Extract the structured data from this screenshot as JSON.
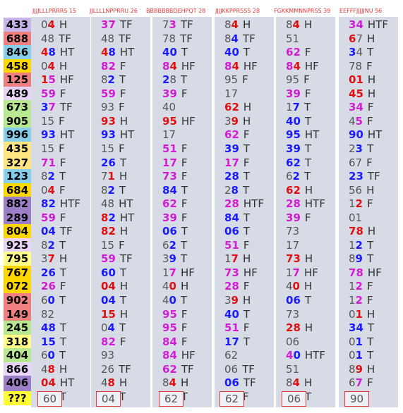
{
  "headers": [
    {
      "label": "JJJJLLLPRRRS 15"
    },
    {
      "label": "JJLLLLNPPRRU 26"
    },
    {
      "label": "BBBBBBBDEHPQT 28"
    },
    {
      "label": "JJJJKKPPRSSS 28"
    },
    {
      "label": "FGKKMMNNPRSS 39"
    },
    {
      "label": "EEFFFJJJJJNU 56"
    }
  ],
  "colors": {
    "blue": "#1a1aff",
    "red": "#e01010",
    "magenta": "#d41cd4",
    "gray": "#555555",
    "black": "#333333"
  },
  "rows": [
    {
      "id": "433",
      "bg": "#c8b4e8",
      "cells": [
        [
          "0",
          "4",
          "H",
          "gray",
          "red"
        ],
        [
          "3",
          "7",
          "TF",
          "magenta",
          "magenta"
        ],
        [
          "7",
          "3",
          "TF",
          "gray",
          "magenta"
        ],
        [
          "8",
          "4",
          "H",
          "gray",
          "red"
        ],
        [
          "8",
          "4",
          "H",
          "gray",
          "red"
        ],
        [
          "3",
          "4",
          "HTF",
          "magenta",
          "magenta"
        ]
      ]
    },
    {
      "id": "688",
      "bg": "#f08080",
      "cells": [
        [
          "4",
          "8",
          "TF",
          "gray",
          "gray"
        ],
        [
          "4",
          "8",
          "TF",
          "gray",
          "gray"
        ],
        [
          "7",
          "8",
          "TF",
          "gray",
          "gray"
        ],
        [
          "8",
          "4",
          "TF",
          "gray",
          "blue"
        ],
        [
          "5",
          "1",
          "",
          "gray",
          "gray"
        ],
        [
          "6",
          "7",
          "H",
          "red",
          "gray"
        ]
      ]
    },
    {
      "id": "846",
      "bg": "#87ceeb",
      "cells": [
        [
          "4",
          "8",
          "HT",
          "red",
          "blue"
        ],
        [
          "4",
          "8",
          "HT",
          "red",
          "blue"
        ],
        [
          "4",
          "0",
          "T",
          "blue",
          "blue"
        ],
        [
          "4",
          "0",
          "T",
          "blue",
          "blue"
        ],
        [
          "6",
          "2",
          "F",
          "magenta",
          "magenta"
        ],
        [
          "3",
          "4",
          "T",
          "blue",
          "gray"
        ]
      ]
    },
    {
      "id": "458",
      "bg": "#ffd700",
      "cells": [
        [
          "0",
          "4",
          "H",
          "gray",
          "red"
        ],
        [
          "8",
          "2",
          "F",
          "magenta",
          "magenta"
        ],
        [
          "8",
          "4",
          "HF",
          "magenta",
          "red"
        ],
        [
          "8",
          "4",
          "HF",
          "magenta",
          "red"
        ],
        [
          "8",
          "4",
          "HF",
          "magenta",
          "red"
        ],
        [
          "7",
          "8",
          "F",
          "gray",
          "gray"
        ]
      ]
    },
    {
      "id": "125",
      "bg": "#f08080",
      "cells": [
        [
          "1",
          "5",
          "HF",
          "red",
          "magenta"
        ],
        [
          "8",
          "2",
          "T",
          "gray",
          "blue"
        ],
        [
          "2",
          "8",
          "T",
          "blue",
          "gray"
        ],
        [
          "9",
          "5",
          "F",
          "gray",
          "gray"
        ],
        [
          "9",
          "5",
          "F",
          "gray",
          "gray"
        ],
        [
          "0",
          "1",
          "H",
          "red",
          "red"
        ]
      ]
    },
    {
      "id": "489",
      "bg": "#e8d4f8",
      "cells": [
        [
          "5",
          "9",
          "F",
          "magenta",
          "magenta"
        ],
        [
          "5",
          "9",
          "F",
          "magenta",
          "magenta"
        ],
        [
          "3",
          "9",
          "F",
          "magenta",
          "magenta"
        ],
        [
          "1",
          "7",
          "",
          "gray",
          "gray"
        ],
        [
          "3",
          "9",
          "F",
          "magenta",
          "magenta"
        ],
        [
          "4",
          "5",
          "H",
          "red",
          "red"
        ]
      ]
    },
    {
      "id": "673",
      "bg": "#b8e890",
      "cells": [
        [
          "3",
          "7",
          "TF",
          "blue",
          "magenta"
        ],
        [
          "9",
          "3",
          "F",
          "gray",
          "gray"
        ],
        [
          "4",
          "0",
          "",
          "gray",
          "gray"
        ],
        [
          "6",
          "2",
          "H",
          "red",
          "red"
        ],
        [
          "1",
          "7",
          "T",
          "gray",
          "blue"
        ],
        [
          "3",
          "4",
          "F",
          "magenta",
          "magenta"
        ]
      ]
    },
    {
      "id": "905",
      "bg": "#b8e890",
      "cells": [
        [
          "1",
          "5",
          "F",
          "gray",
          "gray"
        ],
        [
          "9",
          "3",
          "H",
          "red",
          "red"
        ],
        [
          "9",
          "5",
          "HF",
          "red",
          "red"
        ],
        [
          "3",
          "9",
          "H",
          "gray",
          "red"
        ],
        [
          "4",
          "0",
          "T",
          "blue",
          "blue"
        ],
        [
          "4",
          "5",
          "F",
          "gray",
          "magenta"
        ]
      ]
    },
    {
      "id": "996",
      "bg": "#87ceeb",
      "cells": [
        [
          "9",
          "3",
          "HT",
          "blue",
          "blue"
        ],
        [
          "9",
          "3",
          "HT",
          "blue",
          "blue"
        ],
        [
          "1",
          "7",
          "",
          "gray",
          "gray"
        ],
        [
          "6",
          "2",
          "F",
          "magenta",
          "magenta"
        ],
        [
          "9",
          "5",
          "HT",
          "blue",
          "blue"
        ],
        [
          "9",
          "0",
          "HT",
          "blue",
          "blue"
        ]
      ]
    },
    {
      "id": "435",
      "bg": "#ffe680",
      "cells": [
        [
          "1",
          "5",
          "F",
          "gray",
          "gray"
        ],
        [
          "1",
          "5",
          "F",
          "gray",
          "gray"
        ],
        [
          "5",
          "1",
          "F",
          "magenta",
          "magenta"
        ],
        [
          "3",
          "9",
          "T",
          "blue",
          "blue"
        ],
        [
          "3",
          "9",
          "T",
          "blue",
          "blue"
        ],
        [
          "2",
          "3",
          "T",
          "gray",
          "blue"
        ]
      ]
    },
    {
      "id": "327",
      "bg": "#ffe680",
      "cells": [
        [
          "7",
          "1",
          "F",
          "magenta",
          "magenta"
        ],
        [
          "2",
          "6",
          "T",
          "blue",
          "blue"
        ],
        [
          "1",
          "7",
          "F",
          "magenta",
          "magenta"
        ],
        [
          "1",
          "7",
          "F",
          "magenta",
          "magenta"
        ],
        [
          "6",
          "2",
          "T",
          "blue",
          "blue"
        ],
        [
          "6",
          "7",
          "F",
          "gray",
          "gray"
        ]
      ]
    },
    {
      "id": "123",
      "bg": "#87ceeb",
      "cells": [
        [
          "8",
          "2",
          "T",
          "gray",
          "blue"
        ],
        [
          "7",
          "1",
          "H",
          "gray",
          "red"
        ],
        [
          "7",
          "3",
          "F",
          "magenta",
          "magenta"
        ],
        [
          "2",
          "8",
          "T",
          "blue",
          "blue"
        ],
        [
          "6",
          "2",
          "T",
          "gray",
          "blue"
        ],
        [
          "2",
          "3",
          "TF",
          "blue",
          "blue"
        ]
      ]
    },
    {
      "id": "684",
      "bg": "#ffd700",
      "cells": [
        [
          "0",
          "4",
          "F",
          "gray",
          "red"
        ],
        [
          "8",
          "2",
          "T",
          "gray",
          "blue"
        ],
        [
          "8",
          "4",
          "T",
          "blue",
          "blue"
        ],
        [
          "2",
          "8",
          "T",
          "gray",
          "blue"
        ],
        [
          "6",
          "2",
          "H",
          "red",
          "red"
        ],
        [
          "5",
          "6",
          "H",
          "gray",
          "gray"
        ]
      ]
    },
    {
      "id": "882",
      "bg": "#9b7fc8",
      "cells": [
        [
          "8",
          "2",
          "HTF",
          "blue",
          "blue"
        ],
        [
          "4",
          "8",
          "HT",
          "gray",
          "gray"
        ],
        [
          "6",
          "2",
          "F",
          "magenta",
          "magenta"
        ],
        [
          "2",
          "8",
          "HTF",
          "magenta",
          "magenta"
        ],
        [
          "2",
          "8",
          "HTF",
          "magenta",
          "magenta"
        ],
        [
          "1",
          "2",
          "F",
          "gray",
          "red"
        ]
      ]
    },
    {
      "id": "289",
      "bg": "#9b7fc8",
      "cells": [
        [
          "5",
          "9",
          "F",
          "magenta",
          "magenta"
        ],
        [
          "8",
          "2",
          "HT",
          "red",
          "blue"
        ],
        [
          "3",
          "9",
          "F",
          "magenta",
          "magenta"
        ],
        [
          "8",
          "4",
          "T",
          "blue",
          "blue"
        ],
        [
          "3",
          "9",
          "F",
          "magenta",
          "magenta"
        ],
        [
          "0",
          "1",
          "",
          "gray",
          "gray"
        ]
      ]
    },
    {
      "id": "804",
      "bg": "#ffd700",
      "cells": [
        [
          "0",
          "4",
          "TF",
          "blue",
          "blue"
        ],
        [
          "8",
          "2",
          "H",
          "red",
          "red"
        ],
        [
          "0",
          "6",
          "T",
          "blue",
          "blue"
        ],
        [
          "0",
          "6",
          "T",
          "blue",
          "blue"
        ],
        [
          "7",
          "3",
          "",
          "gray",
          "gray"
        ],
        [
          "7",
          "8",
          "H",
          "red",
          "red"
        ]
      ]
    },
    {
      "id": "925",
      "bg": "#e8d4f8",
      "cells": [
        [
          "8",
          "2",
          "T",
          "gray",
          "blue"
        ],
        [
          "1",
          "5",
          "F",
          "gray",
          "gray"
        ],
        [
          "6",
          "2",
          "T",
          "gray",
          "blue"
        ],
        [
          "5",
          "1",
          "F",
          "magenta",
          "magenta"
        ],
        [
          "1",
          "7",
          "",
          "gray",
          "gray"
        ],
        [
          "1",
          "2",
          "T",
          "gray",
          "blue"
        ]
      ]
    },
    {
      "id": "795",
      "bg": "#ffff88",
      "cells": [
        [
          "3",
          "7",
          "H",
          "gray",
          "red"
        ],
        [
          "5",
          "9",
          "TF",
          "magenta",
          "magenta"
        ],
        [
          "3",
          "9",
          "T",
          "gray",
          "blue"
        ],
        [
          "1",
          "7",
          "H",
          "gray",
          "red"
        ],
        [
          "7",
          "3",
          "H",
          "red",
          "red"
        ],
        [
          "8",
          "9",
          "T",
          "gray",
          "blue"
        ]
      ]
    },
    {
      "id": "767",
      "bg": "#ffd700",
      "cells": [
        [
          "2",
          "6",
          "T",
          "blue",
          "blue"
        ],
        [
          "6",
          "0",
          "T",
          "blue",
          "blue"
        ],
        [
          "1",
          "7",
          "HF",
          "gray",
          "magenta"
        ],
        [
          "7",
          "3",
          "HF",
          "magenta",
          "magenta"
        ],
        [
          "1",
          "7",
          "HF",
          "gray",
          "magenta"
        ],
        [
          "7",
          "8",
          "HF",
          "magenta",
          "magenta"
        ]
      ]
    },
    {
      "id": "072",
      "bg": "#ffd700",
      "cells": [
        [
          "2",
          "6",
          "F",
          "magenta",
          "magenta"
        ],
        [
          "0",
          "4",
          "H",
          "red",
          "red"
        ],
        [
          "4",
          "0",
          "H",
          "gray",
          "red"
        ],
        [
          "2",
          "8",
          "F",
          "magenta",
          "magenta"
        ],
        [
          "4",
          "0",
          "H",
          "gray",
          "red"
        ],
        [
          "1",
          "2",
          "F",
          "gray",
          "magenta"
        ]
      ]
    },
    {
      "id": "902",
      "bg": "#f08080",
      "cells": [
        [
          "6",
          "0",
          "T",
          "gray",
          "blue"
        ],
        [
          "0",
          "4",
          "T",
          "blue",
          "blue"
        ],
        [
          "4",
          "0",
          "T",
          "gray",
          "blue"
        ],
        [
          "3",
          "9",
          "H",
          "gray",
          "red"
        ],
        [
          "0",
          "6",
          "T",
          "blue",
          "blue"
        ],
        [
          "1",
          "2",
          "F",
          "gray",
          "magenta"
        ]
      ]
    },
    {
      "id": "149",
      "bg": "#f08080",
      "cells": [
        [
          "8",
          "2",
          "",
          "gray",
          "gray"
        ],
        [
          "1",
          "5",
          "H",
          "red",
          "red"
        ],
        [
          "9",
          "5",
          "F",
          "magenta",
          "magenta"
        ],
        [
          "4",
          "0",
          "T",
          "blue",
          "blue"
        ],
        [
          "7",
          "3",
          "",
          "gray",
          "gray"
        ],
        [
          "0",
          "1",
          "H",
          "gray",
          "red"
        ]
      ]
    },
    {
      "id": "245",
      "bg": "#b8e890",
      "cells": [
        [
          "4",
          "8",
          "T",
          "blue",
          "blue"
        ],
        [
          "0",
          "4",
          "T",
          "gray",
          "blue"
        ],
        [
          "9",
          "5",
          "F",
          "magenta",
          "magenta"
        ],
        [
          "5",
          "1",
          "F",
          "magenta",
          "magenta"
        ],
        [
          "2",
          "8",
          "H",
          "red",
          "red"
        ],
        [
          "3",
          "4",
          "T",
          "blue",
          "blue"
        ]
      ]
    },
    {
      "id": "318",
      "bg": "#ffff88",
      "cells": [
        [
          "1",
          "5",
          "T",
          "blue",
          "blue"
        ],
        [
          "8",
          "2",
          "F",
          "magenta",
          "magenta"
        ],
        [
          "8",
          "4",
          "F",
          "magenta",
          "magenta"
        ],
        [
          "1",
          "7",
          "T",
          "blue",
          "blue"
        ],
        [
          "0",
          "6",
          "",
          "gray",
          "gray"
        ],
        [
          "0",
          "1",
          "T",
          "gray",
          "blue"
        ]
      ]
    },
    {
      "id": "404",
      "bg": "#b8e890",
      "cells": [
        [
          "6",
          "0",
          "T",
          "gray",
          "blue"
        ],
        [
          "9",
          "3",
          "",
          "gray",
          "gray"
        ],
        [
          "8",
          "4",
          "HF",
          "magenta",
          "magenta"
        ],
        [
          "6",
          "2",
          "",
          "gray",
          "gray"
        ],
        [
          "4",
          "0",
          "HTF",
          "magenta",
          "blue"
        ],
        [
          "0",
          "1",
          "T",
          "gray",
          "blue"
        ]
      ]
    },
    {
      "id": "866",
      "bg": "#e8d4f8",
      "cells": [
        [
          "4",
          "8",
          "H",
          "gray",
          "red"
        ],
        [
          "2",
          "6",
          "TF",
          "gray",
          "gray"
        ],
        [
          "6",
          "2",
          "TF",
          "magenta",
          "magenta"
        ],
        [
          "0",
          "6",
          "TF",
          "gray",
          "gray"
        ],
        [
          "5",
          "1",
          "",
          "gray",
          "gray"
        ],
        [
          "8",
          "9",
          "H",
          "gray",
          "red"
        ]
      ]
    },
    {
      "id": "406",
      "bg": "#9b7fc8",
      "cells": [
        [
          "0",
          "4",
          "HT",
          "red",
          "red"
        ],
        [
          "4",
          "8",
          "H",
          "gray",
          "red"
        ],
        [
          "8",
          "4",
          "H",
          "gray",
          "red"
        ],
        [
          "0",
          "6",
          "TF",
          "blue",
          "blue"
        ],
        [
          "8",
          "4",
          "H",
          "gray",
          "red"
        ],
        [
          "6",
          "7",
          "F",
          "gray",
          "magenta"
        ]
      ]
    },
    {
      "id": "297",
      "bg": "#9b7fc8",
      "cells": [
        [
          "9",
          "3",
          "T",
          "blue",
          "blue"
        ],
        [
          "5",
          "9",
          "T",
          "gray",
          "blue"
        ],
        [
          "9",
          "5",
          "T",
          "blue",
          "blue"
        ],
        [
          "1",
          "7",
          "F",
          "gray",
          "magenta"
        ],
        [
          "9",
          "5",
          "T",
          "blue",
          "blue"
        ],
        [
          "3",
          "4",
          "",
          "gray",
          "gray"
        ]
      ]
    }
  ],
  "answer": {
    "label": "???",
    "values": [
      "60",
      "04",
      "62",
      "62",
      "06",
      "90"
    ]
  }
}
